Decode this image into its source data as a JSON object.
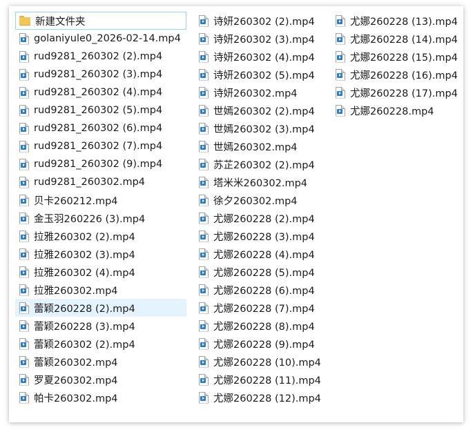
{
  "files": {
    "column1": [
      {
        "name": "新建文件夹",
        "type": "folder"
      },
      {
        "name": "golaniyule0_2026-02-14.mp4",
        "type": "video"
      },
      {
        "name": "rud9281_260302 (2).mp4",
        "type": "video"
      },
      {
        "name": "rud9281_260302 (3).mp4",
        "type": "video"
      },
      {
        "name": "rud9281_260302 (4).mp4",
        "type": "video"
      },
      {
        "name": "rud9281_260302 (5).mp4",
        "type": "video"
      },
      {
        "name": "rud9281_260302 (6).mp4",
        "type": "video"
      },
      {
        "name": "rud9281_260302 (7).mp4",
        "type": "video"
      },
      {
        "name": "rud9281_260302 (9).mp4",
        "type": "video"
      },
      {
        "name": "rud9281_260302.mp4",
        "type": "video"
      },
      {
        "name": "贝卡260212.mp4",
        "type": "video"
      },
      {
        "name": "金玉羽260226 (3).mp4",
        "type": "video"
      },
      {
        "name": "拉雅260302 (2).mp4",
        "type": "video"
      },
      {
        "name": "拉雅260302 (3).mp4",
        "type": "video"
      },
      {
        "name": "拉雅260302 (4).mp4",
        "type": "video"
      },
      {
        "name": "拉雅260302.mp4",
        "type": "video"
      },
      {
        "name": "蕾颖260228 (2).mp4",
        "type": "video"
      },
      {
        "name": "蕾颖260228 (3).mp4",
        "type": "video"
      },
      {
        "name": "蕾颖260302 (2).mp4",
        "type": "video"
      },
      {
        "name": "蕾颖260302.mp4",
        "type": "video"
      },
      {
        "name": "罗夏260302.mp4",
        "type": "video"
      },
      {
        "name": "帕卡260302.mp4",
        "type": "video"
      }
    ],
    "column2": [
      {
        "name": "诗妍260302 (2).mp4",
        "type": "video"
      },
      {
        "name": "诗妍260302 (3).mp4",
        "type": "video"
      },
      {
        "name": "诗妍260302 (4).mp4",
        "type": "video"
      },
      {
        "name": "诗妍260302 (5).mp4",
        "type": "video"
      },
      {
        "name": "诗妍260302.mp4",
        "type": "video"
      },
      {
        "name": "世嫣260302 (2).mp4",
        "type": "video"
      },
      {
        "name": "世嫣260302 (3).mp4",
        "type": "video"
      },
      {
        "name": "世嫣260302.mp4",
        "type": "video"
      },
      {
        "name": "苏芷260302 (2).mp4",
        "type": "video"
      },
      {
        "name": "塔米米260302.mp4",
        "type": "video"
      },
      {
        "name": "徐夕260302.mp4",
        "type": "video"
      },
      {
        "name": "尤娜260228 (2).mp4",
        "type": "video"
      },
      {
        "name": "尤娜260228 (3).mp4",
        "type": "video"
      },
      {
        "name": "尤娜260228 (4).mp4",
        "type": "video"
      },
      {
        "name": "尤娜260228 (5).mp4",
        "type": "video"
      },
      {
        "name": "尤娜260228 (6).mp4",
        "type": "video"
      },
      {
        "name": "尤娜260228 (7).mp4",
        "type": "video"
      },
      {
        "name": "尤娜260228 (8).mp4",
        "type": "video"
      },
      {
        "name": "尤娜260228 (9).mp4",
        "type": "video"
      },
      {
        "name": "尤娜260228 (10).mp4",
        "type": "video"
      },
      {
        "name": "尤娜260228 (11).mp4",
        "type": "video"
      },
      {
        "name": "尤娜260228 (12).mp4",
        "type": "video"
      }
    ],
    "column3": [
      {
        "name": "尤娜260228 (13).mp4",
        "type": "video"
      },
      {
        "name": "尤娜260228 (14).mp4",
        "type": "video"
      },
      {
        "name": "尤娜260228 (15).mp4",
        "type": "video"
      },
      {
        "name": "尤娜260228 (16).mp4",
        "type": "video"
      },
      {
        "name": "尤娜260228 (17).mp4",
        "type": "video"
      },
      {
        "name": "尤娜260228.mp4",
        "type": "video"
      }
    ]
  },
  "state": {
    "focused_item": "新建文件夹",
    "hovered_item": "蕾颖260228 (2).mp4"
  },
  "colors": {
    "hover_background": "#e5f3ff",
    "focus_border": "#99d1ff",
    "folder": "#f3c65a",
    "video_badge": "#2e7cc4"
  }
}
